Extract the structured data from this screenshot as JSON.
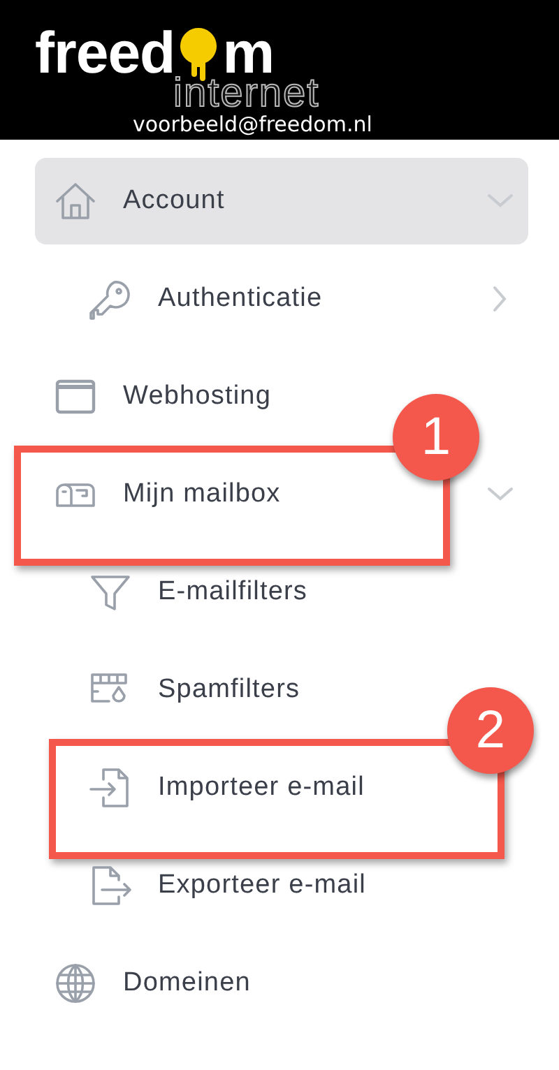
{
  "header": {
    "logo_parts": [
      "freed",
      "m"
    ],
    "logo_subtitle": "internet",
    "email": "voorbeeld@freedom.nl"
  },
  "menu": [
    {
      "label": "Account",
      "selected": true,
      "expanded": true,
      "children": [
        {
          "label": "Authenticatie",
          "selected": false,
          "submenu": true
        }
      ]
    },
    {
      "label": "Webhosting",
      "selected": false
    },
    {
      "label": "Mijn mailbox",
      "selected": false,
      "expanded": true,
      "callout": "1",
      "children": [
        {
          "label": "E-mailfilters",
          "selected": false
        },
        {
          "label": "Spamfilters",
          "selected": false
        },
        {
          "label": "Importeer e-mail",
          "selected": false,
          "callout": "2"
        },
        {
          "label": "Exporteer e-mail",
          "selected": false
        }
      ]
    },
    {
      "label": "Domeinen",
      "selected": false
    }
  ]
}
